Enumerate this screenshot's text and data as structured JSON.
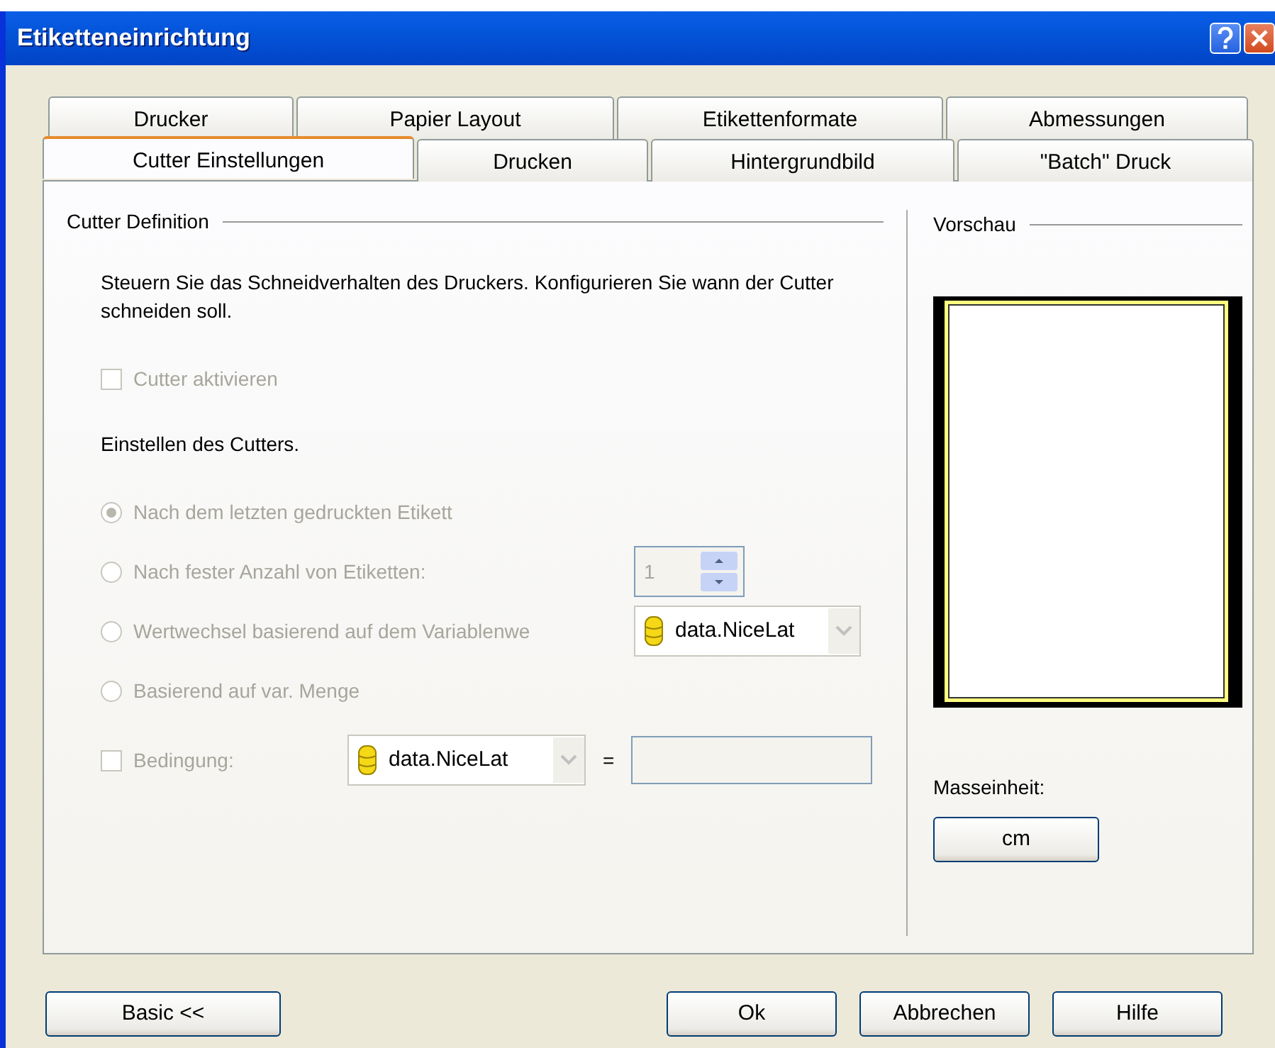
{
  "window": {
    "title": "Etiketteneinrichtung"
  },
  "tab_rows": [
    {
      "tabs": [
        {
          "label": "Drucker",
          "selected": false
        },
        {
          "label": "Papier Layout",
          "selected": false
        },
        {
          "label": "Etikettenformate",
          "selected": false
        },
        {
          "label": "Abmessungen",
          "selected": false
        }
      ]
    },
    {
      "tabs": [
        {
          "label": "Cutter Einstellungen",
          "selected": true
        },
        {
          "label": "Drucken",
          "selected": false
        },
        {
          "label": "Hintergrundbild",
          "selected": false
        },
        {
          "label": "\"Batch\" Druck",
          "selected": false
        }
      ]
    }
  ],
  "cutter_definition": {
    "title": "Cutter Definition",
    "description": "Steuern Sie das Schneidverhalten des Druckers. Konfigurieren Sie wann der Cutter schneiden soll.",
    "enable_checkbox": {
      "label": "Cutter aktivieren",
      "checked": false,
      "disabled": true
    },
    "options_label": "Einstellen des Cutters.",
    "options": [
      {
        "label": "Nach dem letzten gedruckten Etikett",
        "selected": true,
        "disabled": true
      },
      {
        "label": "Nach fester Anzahl von Etiketten:",
        "selected": false,
        "disabled": true,
        "control": {
          "kind": "spinner",
          "value": "1"
        }
      },
      {
        "label": "Wertwechsel basierend auf dem Variablenwe",
        "selected": false,
        "disabled": true,
        "control": {
          "kind": "combo",
          "value": "data.NiceLat"
        }
      },
      {
        "label": "Basierend auf var. Menge",
        "selected": false,
        "disabled": true
      }
    ],
    "condition": {
      "label": "Bedingung:",
      "checked": false,
      "disabled": true,
      "variable": "data.NiceLat",
      "operator": "="
    }
  },
  "preview": {
    "title": "Vorschau",
    "unit_label": "Masseinheit:",
    "unit_button": "cm"
  },
  "buttons": {
    "left": "Basic <<",
    "right": [
      "Ok",
      "Abbrechen",
      "Hilfe"
    ]
  }
}
